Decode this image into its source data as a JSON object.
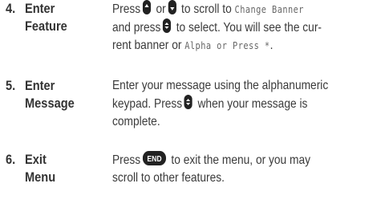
{
  "steps": [
    {
      "number": "4.",
      "title": [
        "Enter",
        "Feature"
      ],
      "body": {
        "press": "Press",
        "or": "or",
        "to_scroll": "to scroll to",
        "menu_item": "Change Banner",
        "and_press": "and press",
        "to_select": "to select. You will see the cur-",
        "rent_banner": "rent banner or",
        "alt_display": "Alpha or Press *",
        "period": "."
      }
    },
    {
      "number": "5.",
      "title": [
        "Enter",
        "Message"
      ],
      "body": {
        "line1": "Enter your message using the alphanumeric",
        "keypad_press": "keypad. Press",
        "when_complete": "when your message is",
        "line3": "complete."
      }
    },
    {
      "number": "6.",
      "title": [
        "Exit",
        "Menu"
      ],
      "body": {
        "press": "Press",
        "end_key": "END",
        "to_exit": "to exit the menu, or you may",
        "line2": "scroll to other features."
      }
    }
  ]
}
